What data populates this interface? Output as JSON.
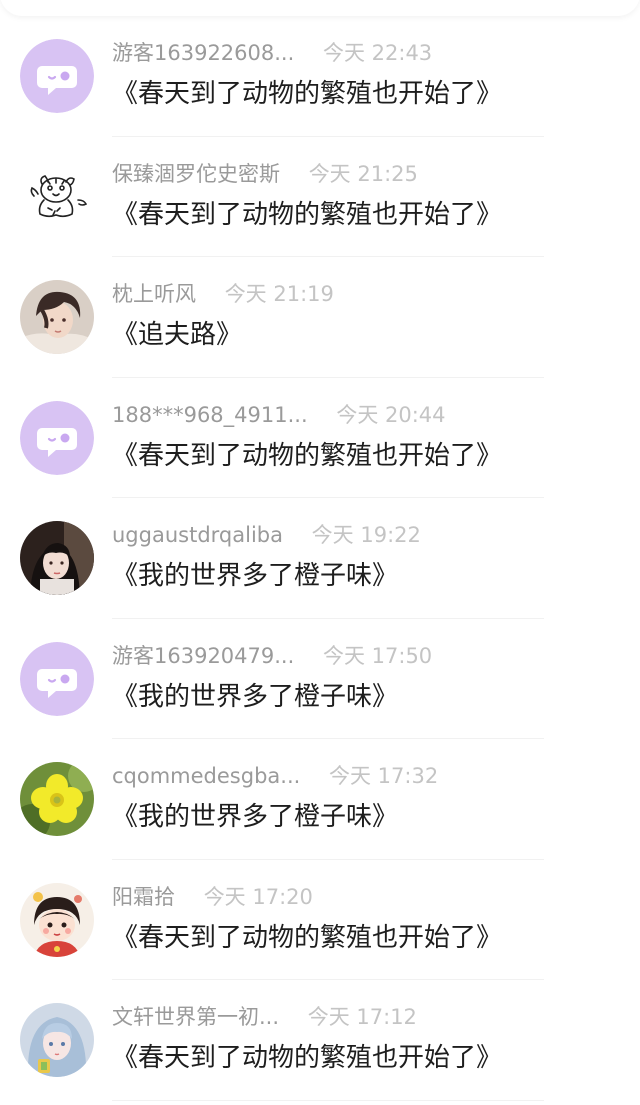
{
  "comments": [
    {
      "username": "游客163922608...",
      "time": "今天 22:43",
      "title": "《春天到了动物的繁殖也开始了》",
      "avatar": "default-chat-bubble-avatar"
    },
    {
      "username": "保臻涸罗佗史密斯",
      "time": "今天 21:25",
      "title": "《春天到了动物的繁殖也开始了》",
      "avatar": "tiger-sketch-avatar"
    },
    {
      "username": "枕上听风",
      "time": "今天 21:19",
      "title": "《追夫路》",
      "avatar": "anime-boy-avatar"
    },
    {
      "username": "188***968_4911...",
      "time": "今天 20:44",
      "title": "《春天到了动物的繁殖也开始了》",
      "avatar": "default-chat-bubble-avatar"
    },
    {
      "username": "uggaustdrqaliba",
      "time": "今天 19:22",
      "title": "《我的世界多了橙子味》",
      "avatar": "girl-photo-avatar"
    },
    {
      "username": "游客163920479...",
      "time": "今天 17:50",
      "title": "《我的世界多了橙子味》",
      "avatar": "default-chat-bubble-avatar"
    },
    {
      "username": "cqommedesgba...",
      "time": "今天 17:32",
      "title": "《我的世界多了橙子味》",
      "avatar": "yellow-flower-avatar"
    },
    {
      "username": "阳霜拾",
      "time": "今天 17:20",
      "title": "《春天到了动物的繁殖也开始了》",
      "avatar": "cartoon-girl-avatar"
    },
    {
      "username": "文轩世界第一初...",
      "time": "今天 17:12",
      "title": "《春天到了动物的繁殖也开始了》",
      "avatar": "anime-girl-avatar"
    }
  ],
  "colors": {
    "default_avatar_bg": "#d8c3f3",
    "username": "#9a9a9a",
    "time": "#c4c4c4",
    "title": "#1e1e1e"
  }
}
